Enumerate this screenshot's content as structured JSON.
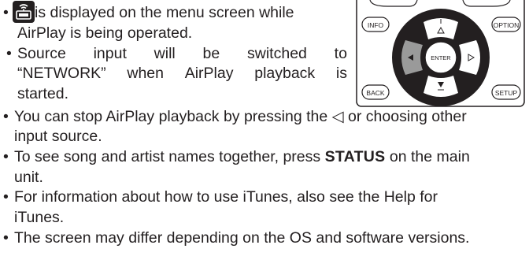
{
  "bullets": {
    "b1": {
      "line1": " is displayed on the menu screen while",
      "line2": "AirPlay is being operated."
    },
    "b2": {
      "words1": [
        "Source",
        "input",
        "will",
        "be",
        "switched",
        "to"
      ],
      "words2": [
        "“NETWORK”",
        "when",
        "AirPlay",
        "playback",
        "is"
      ],
      "line3": "started."
    },
    "b3": {
      "line1a": "You can stop AirPlay playback by pressing the ",
      "arrow": "◁",
      "line1b": " or choosing other",
      "line2": "input source."
    },
    "b4": {
      "line1a": "To see song and artist names together, press ",
      "bold": "STATUS",
      "line1b": " on the main",
      "line2": "unit."
    },
    "b5": {
      "line1": "For information about how to use iTunes, also see the Help for",
      "line2": "iTunes."
    },
    "b6": {
      "line1": "The screen may differ depending on the OS and software versions."
    }
  },
  "remote": {
    "info": "INFO",
    "option": "OPTION",
    "enter": "ENTER",
    "back": "BACK",
    "setup": "SETUP"
  },
  "icons": {
    "airplay": "airplay-device-icon"
  }
}
